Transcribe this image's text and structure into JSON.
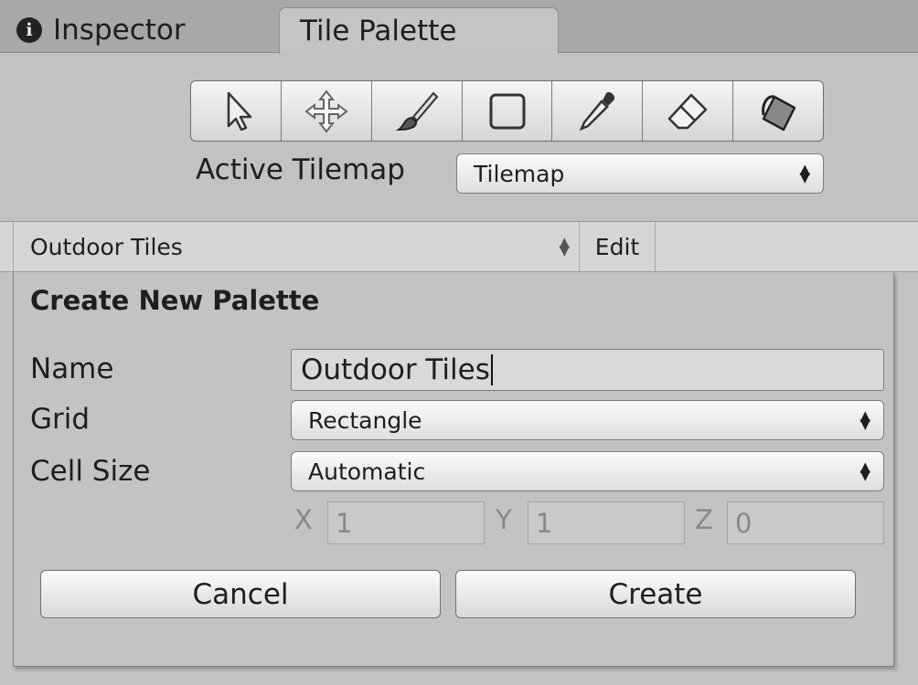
{
  "tabs": [
    {
      "label": "Inspector",
      "icon": "info-icon",
      "active": false
    },
    {
      "label": "Tile Palette",
      "active": true
    }
  ],
  "toolbar": {
    "tools": [
      {
        "name": "select-tool",
        "icon": "arrow-cursor-icon"
      },
      {
        "name": "move-tool",
        "icon": "move-arrows-icon"
      },
      {
        "name": "paint-tool",
        "icon": "paintbrush-icon"
      },
      {
        "name": "box-fill-tool",
        "icon": "rectangle-icon"
      },
      {
        "name": "picker-tool",
        "icon": "eyedropper-icon"
      },
      {
        "name": "erase-tool",
        "icon": "eraser-icon"
      },
      {
        "name": "fill-tool",
        "icon": "paint-bucket-icon"
      }
    ]
  },
  "active_tilemap": {
    "label": "Active Tilemap",
    "value": "Tilemap"
  },
  "palette_bar": {
    "selected_palette": "Outdoor Tiles",
    "edit_label": "Edit"
  },
  "create_panel": {
    "title": "Create New Palette",
    "name_label": "Name",
    "name_value": "Outdoor Tiles",
    "grid_label": "Grid",
    "grid_value": "Rectangle",
    "cell_size_label": "Cell Size",
    "cell_size_value": "Automatic",
    "x_label": "X",
    "x_value": "1",
    "y_label": "Y",
    "y_value": "1",
    "z_label": "Z",
    "z_value": "0",
    "cancel_label": "Cancel",
    "create_label": "Create"
  }
}
